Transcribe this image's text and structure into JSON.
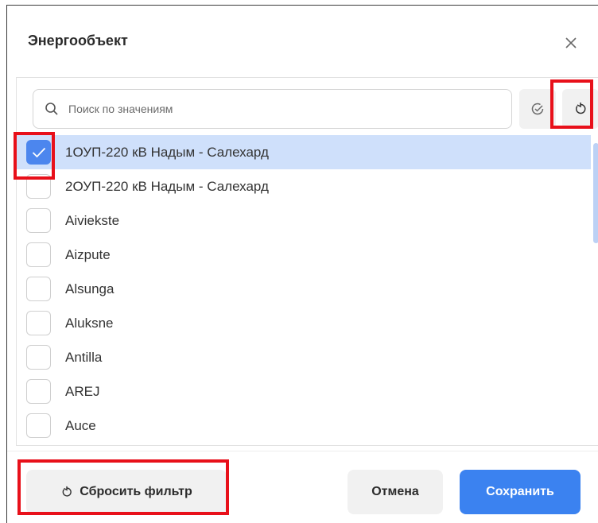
{
  "dialog": {
    "title": "Энергообъект"
  },
  "search": {
    "placeholder": "Поиск по значениям",
    "value": ""
  },
  "list": {
    "items": [
      {
        "label": "1ОУП-220 кВ Надым - Салехард",
        "checked": true
      },
      {
        "label": "2ОУП-220 кВ Надым - Салехард",
        "checked": false
      },
      {
        "label": "Aiviekste",
        "checked": false
      },
      {
        "label": "Aizpute",
        "checked": false
      },
      {
        "label": "Alsunga",
        "checked": false
      },
      {
        "label": "Aluksne",
        "checked": false
      },
      {
        "label": "Antilla",
        "checked": false
      },
      {
        "label": "AREJ",
        "checked": false
      },
      {
        "label": "Auce",
        "checked": false
      }
    ]
  },
  "footer": {
    "reset_label": "Сбросить фильтр",
    "cancel_label": "Отмена",
    "save_label": "Сохранить"
  },
  "colors": {
    "accent": "#3b82f0",
    "selected_row": "#cfe0fb",
    "highlight": "#e8101a"
  }
}
